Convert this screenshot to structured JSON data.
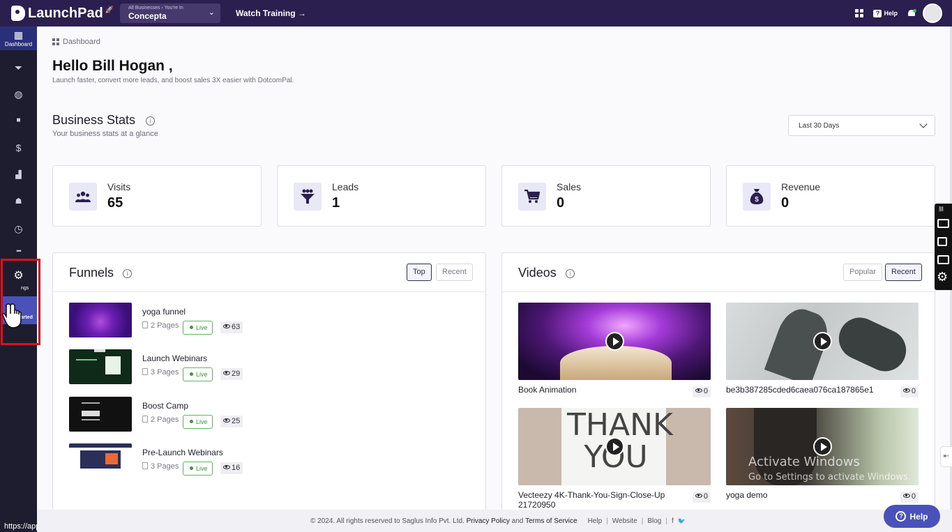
{
  "app": {
    "name": "LaunchPad",
    "logo_icon": "launchpad-logo-icon"
  },
  "header": {
    "business_crumb": "All Businesses › You're In",
    "business_name": "Concepta",
    "watch_training": "Watch Training →",
    "help_label": "Help"
  },
  "sidebar": {
    "items": [
      {
        "name": "Dashboard",
        "icon": "dashboard-icon",
        "glyph": "▦"
      },
      {
        "name": "Funnels",
        "icon": "funnel-icon",
        "glyph": "⏷"
      },
      {
        "name": "Websites",
        "icon": "globe-icon",
        "glyph": "◍"
      },
      {
        "name": "Videos",
        "icon": "video-icon",
        "glyph": "■"
      },
      {
        "name": "Sales",
        "icon": "dollar-icon",
        "glyph": "$"
      },
      {
        "name": "Analytics",
        "icon": "chart-icon",
        "glyph": "▟"
      },
      {
        "name": "Contacts",
        "icon": "users-icon",
        "glyph": "☗"
      },
      {
        "name": "Reports",
        "icon": "clock-icon",
        "glyph": "◷"
      },
      {
        "name": "More",
        "icon": "more-icon",
        "glyph": "•••"
      }
    ],
    "settings_label": "ngs",
    "settings_glyph": "⚙",
    "get_started": "Get Started"
  },
  "status_url": "https://apps.dotcompal.com/settings",
  "breadcrumb": "Dashboard",
  "greeting": "Hello Bill Hogan ,",
  "greeting_sub": "Launch faster, convert more leads, and boost sales 3X easier with DotcomPal.",
  "business_stats": {
    "title": "Business Stats",
    "subtitle": "Your business stats at a glance",
    "range": "Last 30 Days",
    "cards": [
      {
        "label": "Visits",
        "value": "65",
        "icon": "users-icon",
        "glyph": "👥"
      },
      {
        "label": "Leads",
        "value": "1",
        "icon": "funnel-icon",
        "glyph": "⏷"
      },
      {
        "label": "Sales",
        "value": "0",
        "icon": "cart-icon",
        "glyph": "🛒"
      },
      {
        "label": "Revenue",
        "value": "0",
        "icon": "money-bag-icon",
        "glyph": "$"
      }
    ]
  },
  "funnels": {
    "title": "Funnels",
    "tabs": [
      "Top",
      "Recent"
    ],
    "active_tab": "Top",
    "items": [
      {
        "name": "yoga funnel",
        "pages": "2 Pages",
        "status": "Live",
        "views": "63"
      },
      {
        "name": "Launch Webinars",
        "pages": "3 Pages",
        "status": "Live",
        "views": "29"
      },
      {
        "name": "Boost Camp",
        "pages": "2 Pages",
        "status": "Live",
        "views": "25"
      },
      {
        "name": "Pre-Launch Webinars",
        "pages": "3 Pages",
        "status": "Live",
        "views": "16"
      }
    ]
  },
  "videos": {
    "title": "Videos",
    "tabs": [
      "Popular",
      "Recent"
    ],
    "active_tab": "Recent",
    "items": [
      {
        "name": "Book Animation",
        "views": "0"
      },
      {
        "name": "be3b387285cded6caea076ca187865e1",
        "views": "0"
      },
      {
        "name": "Vecteezy 4K-Thank-You-Sign-Close-Up 21720950",
        "views": "0",
        "thumb_text": "THANK YOU"
      },
      {
        "name": "yoga demo",
        "views": "0"
      }
    ]
  },
  "watermark": {
    "title": "Activate Windows",
    "subtitle": "Go to Settings to activate Windows."
  },
  "footer": {
    "copyright": "©  2024. All rights reserved to Saglus Info Pvt. Ltd.",
    "privacy": "Privacy Policy",
    "and": "and",
    "terms": "Terms of Service",
    "links": [
      "Help",
      "Website",
      "Blog"
    ],
    "social": [
      "f",
      "🐦"
    ]
  },
  "help_button": "Help",
  "colors": {
    "topbar": "#2a1f4f",
    "sidebar": "#1e1d2f",
    "accent": "#4a51b8",
    "live": "#3a9a3a",
    "highlight": "#e0101a"
  }
}
